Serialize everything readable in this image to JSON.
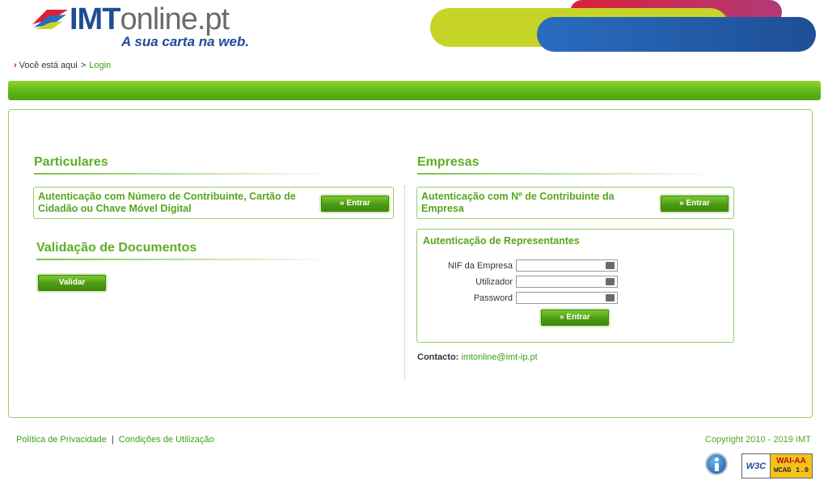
{
  "header": {
    "logo": {
      "imt": "IMT",
      "online": "online.pt",
      "slogan": "A sua carta na web."
    },
    "banner_colors": {
      "red": "#d8213b",
      "lime": "#c6d427",
      "blue": "#2a6cc0"
    }
  },
  "breadcrumb": {
    "prefix": "Você está aqui",
    "separator": ">",
    "current": "Login"
  },
  "particulares": {
    "title": "Particulares",
    "auth_text": "Autenticação com Número de Contribuinte, Cartão de Cidadão ou Chave Móvel Digital",
    "button": "» Entrar"
  },
  "validacao": {
    "title": "Validação de Documentos",
    "button": "Validar"
  },
  "empresas": {
    "title": "Empresas",
    "auth_text": "Autenticação com Nº de Contribuinte da Empresa",
    "button": "» Entrar"
  },
  "representantes": {
    "title": "Autenticação de Representantes",
    "fields": [
      {
        "label": "NIF da Empresa",
        "value": ""
      },
      {
        "label": "Utilizador",
        "value": ""
      },
      {
        "label": "Password",
        "value": ""
      }
    ],
    "button": "» Entrar"
  },
  "contact": {
    "label": "Contacto:",
    "email": "imtonline@imt-ip.pt"
  },
  "footer": {
    "privacy": "Política de Privacidade",
    "separator": "|",
    "terms": "Condições de Utilização",
    "copyright": "Copyright 2010 - 2019 IMT",
    "accessibility_icon": "accessibility-icon",
    "w3c": {
      "logo": "W3C",
      "level": "WAI-AA",
      "wcag": "WCAG 1.0"
    }
  },
  "colors": {
    "accent_green": "#5fae22",
    "link_green": "#3aa117",
    "brand_blue": "#1f4d96"
  }
}
